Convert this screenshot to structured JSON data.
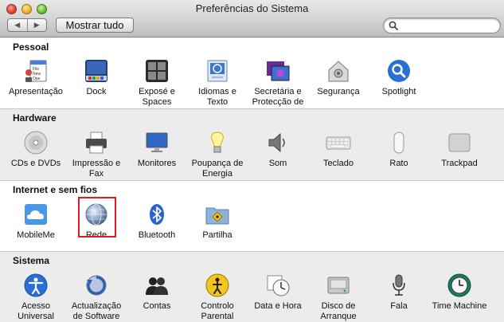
{
  "window": {
    "title": "Preferências do Sistema",
    "show_all_label": "Mostrar tudo",
    "nav_back": "◀",
    "nav_forward": "▶",
    "search": {
      "value": "",
      "placeholder": ""
    }
  },
  "sections": {
    "pessoal": {
      "title": "Pessoal",
      "items": [
        {
          "label": "Apresentação",
          "icon": "appearance-icon"
        },
        {
          "label": "Dock",
          "icon": "dock-icon"
        },
        {
          "label": "Exposé e Spaces",
          "icon": "expose-spaces-icon"
        },
        {
          "label": "Idiomas e Texto",
          "icon": "language-text-icon"
        },
        {
          "label": "Secretária e Protecção de Ecrã",
          "icon": "desktop-screensaver-icon"
        },
        {
          "label": "Segurança",
          "icon": "security-icon"
        },
        {
          "label": "Spotlight",
          "icon": "spotlight-icon"
        }
      ]
    },
    "hardware": {
      "title": "Hardware",
      "items": [
        {
          "label": "CDs e DVDs",
          "icon": "cd-dvd-icon"
        },
        {
          "label": "Impressão e Fax",
          "icon": "printer-icon"
        },
        {
          "label": "Monitores",
          "icon": "monitor-icon"
        },
        {
          "label": "Poupança de Energia",
          "icon": "energy-saver-icon"
        },
        {
          "label": "Som",
          "icon": "speaker-icon"
        },
        {
          "label": "Teclado",
          "icon": "keyboard-icon"
        },
        {
          "label": "Rato",
          "icon": "mouse-icon"
        },
        {
          "label": "Trackpad",
          "icon": "trackpad-icon"
        }
      ]
    },
    "internet": {
      "title": "Internet e sem fios",
      "items": [
        {
          "label": "MobileMe",
          "icon": "mobileme-cloud-icon"
        },
        {
          "label": "Rede",
          "icon": "network-globe-icon"
        },
        {
          "label": "Bluetooth",
          "icon": "bluetooth-icon"
        },
        {
          "label": "Partilha",
          "icon": "sharing-folder-icon"
        }
      ]
    },
    "sistema": {
      "title": "Sistema",
      "items": [
        {
          "label": "Acesso Universal",
          "icon": "universal-access-icon"
        },
        {
          "label": "Actualização de Software",
          "icon": "software-update-icon"
        },
        {
          "label": "Contas",
          "icon": "accounts-icon"
        },
        {
          "label": "Controlo Parental",
          "icon": "parental-controls-icon"
        },
        {
          "label": "Data e Hora",
          "icon": "date-time-icon"
        },
        {
          "label": "Disco de Arranque",
          "icon": "startup-disk-icon"
        },
        {
          "label": "Fala",
          "icon": "speech-microphone-icon"
        },
        {
          "label": "Time Machine",
          "icon": "time-machine-icon"
        }
      ]
    }
  },
  "highlighted_item": "Rede",
  "colors": {
    "highlight_border": "#e01a22",
    "accent_blue": "#2a6fd6"
  }
}
